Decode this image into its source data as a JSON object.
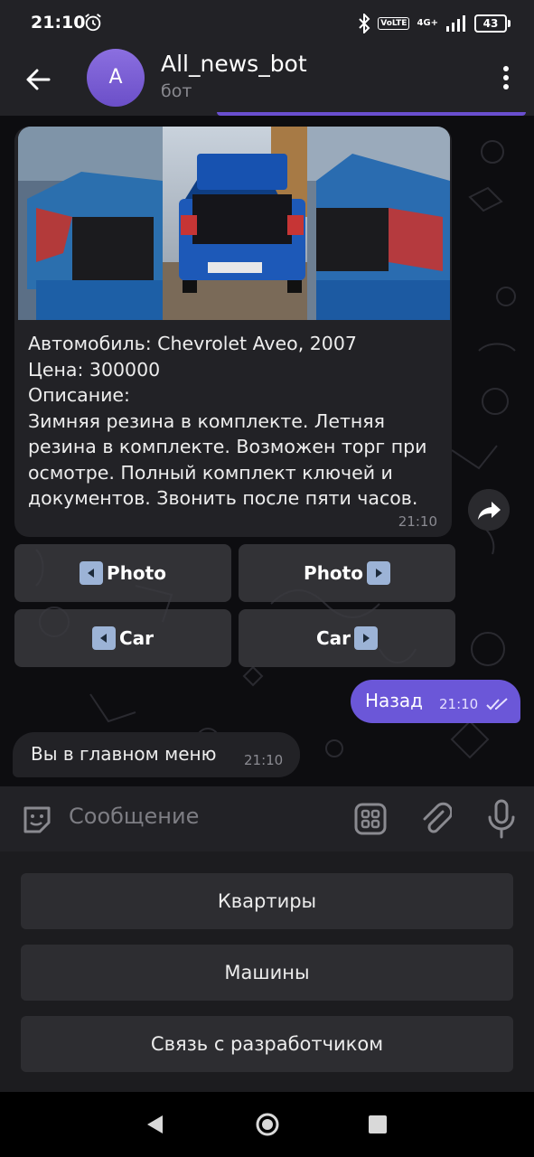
{
  "status_bar": {
    "time": "21:10",
    "network": "4G+",
    "volte": "VoLTE",
    "battery": "43"
  },
  "header": {
    "avatar_letter": "A",
    "title": "All_news_bot",
    "subtitle": "бот"
  },
  "chat": {
    "card_message": {
      "text": "Автомобиль: Chevrolet Aveo, 2007\nЦена: 300000\nОписание:\nЗимняя резина в комплекте. Летняя резина в комплекте. Возможен торг при осмотре. Полный комплект ключей и документов. Звонить после пяти часов.",
      "time": "21:10"
    },
    "inline_keyboard": [
      {
        "label": "Photo",
        "arrow": "left"
      },
      {
        "label": "Photo",
        "arrow": "right"
      },
      {
        "label": "Car",
        "arrow": "left"
      },
      {
        "label": "Car",
        "arrow": "right"
      }
    ],
    "outgoing": {
      "text": "Назад",
      "time": "21:10"
    },
    "incoming": {
      "text": "Вы в главном меню",
      "time": "21:10"
    }
  },
  "input": {
    "placeholder": "Сообщение"
  },
  "reply_keyboard": {
    "buttons": [
      "Квартиры",
      "Машины",
      "Связь с разработчиком"
    ]
  },
  "colors": {
    "accent": "#6b57d8",
    "bubble_in": "#222226",
    "background": "#0d0d10"
  },
  "icons": [
    "back-arrow-icon",
    "more-vert-icon",
    "sticker-icon",
    "grid-icon",
    "paperclip-icon",
    "mic-icon",
    "forward-icon",
    "double-check-icon"
  ]
}
